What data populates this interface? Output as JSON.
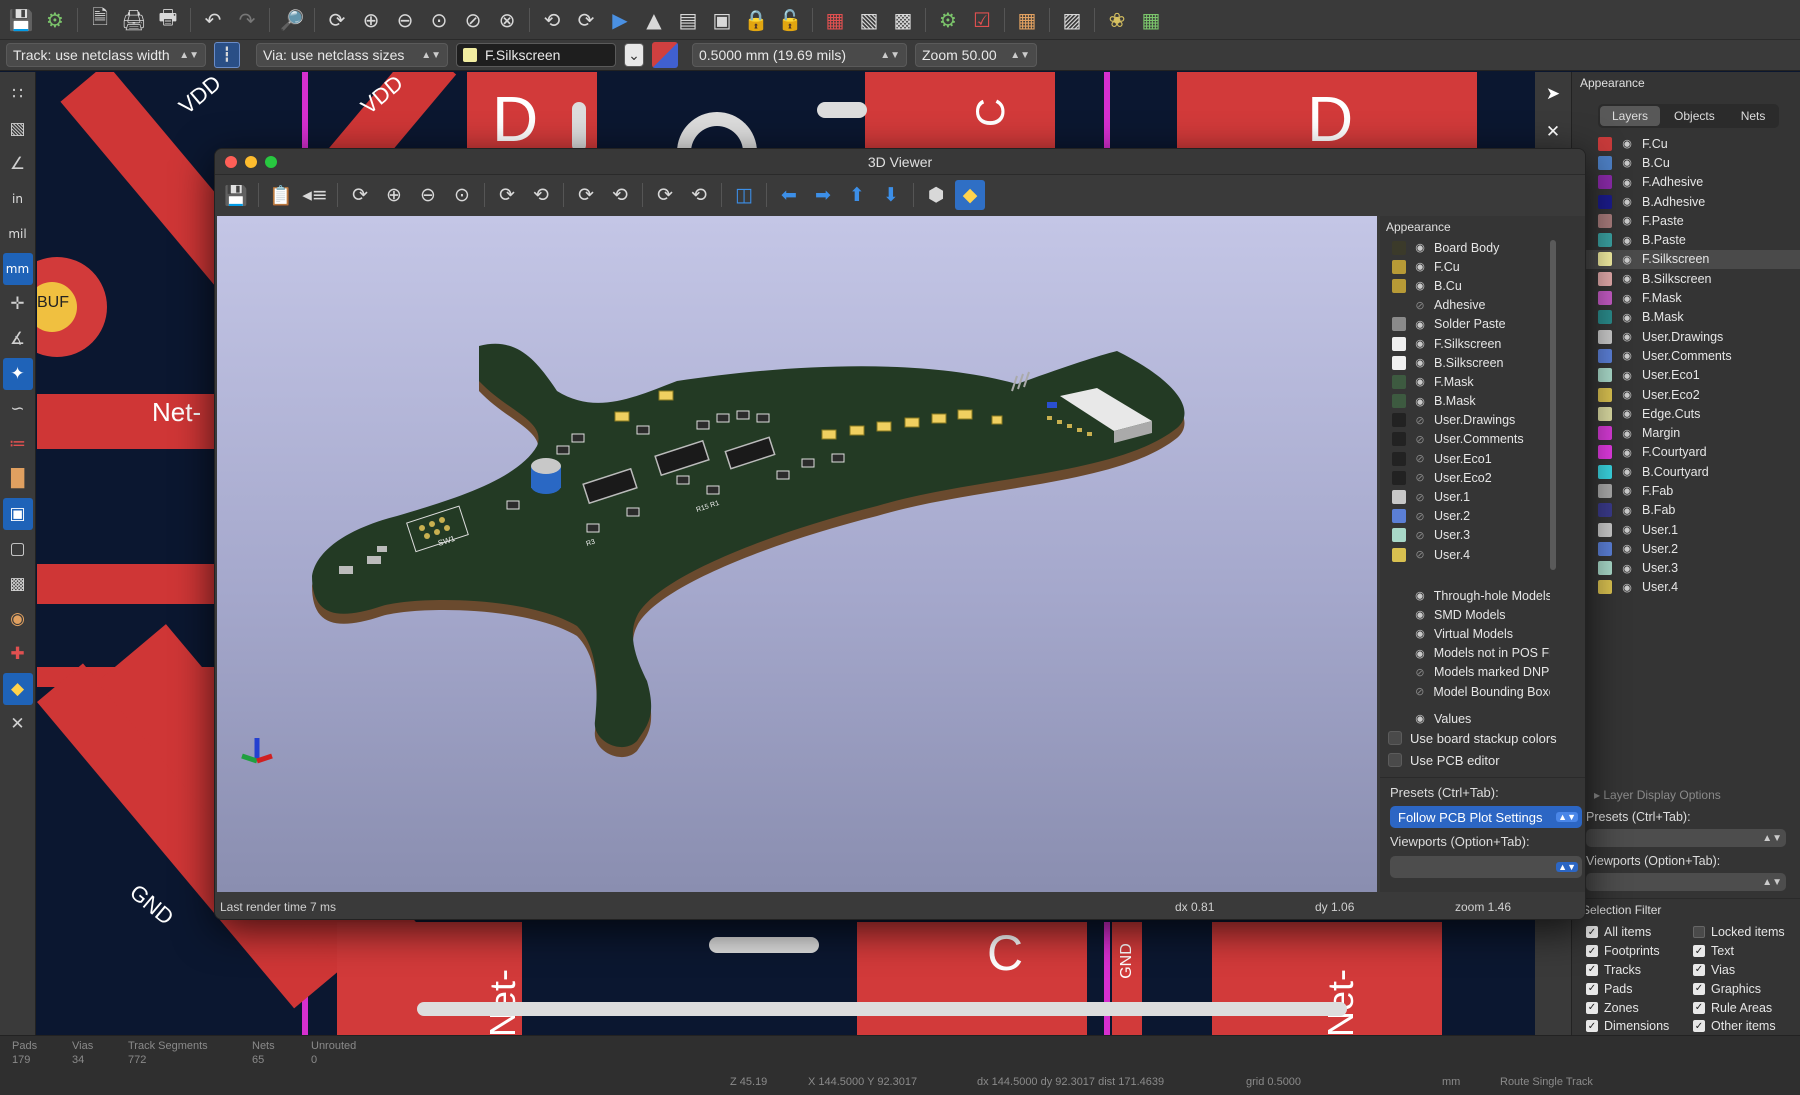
{
  "toolbar2": {
    "track_width": "Track: use netclass width",
    "via_size": "Via: use netclass sizes",
    "active_layer": "F.Silkscreen",
    "grid": "0.5000 mm (19.69 mils)",
    "zoom": "Zoom 50.00"
  },
  "left_toolbar": {
    "in": "in",
    "mil": "mil",
    "mm": "mm"
  },
  "canvas": {
    "labels": {
      "vdd1": "VDD",
      "vdd2": "VDD",
      "net_left": "Net-",
      "buf": "BUF",
      "gnd": "GND",
      "gnd2": "GND",
      "net_b1": "Net-",
      "net_b2": "Net-",
      "d1": "D",
      "d2": "D",
      "c1": "C",
      "c2": "C"
    }
  },
  "viewer": {
    "title": "3D Viewer",
    "status": {
      "render_time": "Last render time 7 ms",
      "dx": "dx 0.81",
      "dy": "dy 1.06",
      "zoom": "zoom 1.46"
    },
    "appearance_title": "Appearance",
    "layers": [
      {
        "name": "Board Body",
        "color": "#3b3a2a",
        "eye": true
      },
      {
        "name": "F.Cu",
        "color": "#b79a36",
        "eye": true
      },
      {
        "name": "B.Cu",
        "color": "#b79a36",
        "eye": true
      },
      {
        "name": "Adhesive",
        "color": "",
        "eye": false
      },
      {
        "name": "Solder Paste",
        "color": "#8a8a8a",
        "eye": true
      },
      {
        "name": "F.Silkscreen",
        "color": "#f0f0f0",
        "eye": true
      },
      {
        "name": "B.Silkscreen",
        "color": "#f0f0f0",
        "eye": true
      },
      {
        "name": "F.Mask",
        "color": "#3d5a40",
        "eye": true
      },
      {
        "name": "B.Mask",
        "color": "#3d5a40",
        "eye": true
      },
      {
        "name": "User.Drawings",
        "color": "#222222",
        "eye": false
      },
      {
        "name": "User.Comments",
        "color": "#222222",
        "eye": false
      },
      {
        "name": "User.Eco1",
        "color": "#222222",
        "eye": false
      },
      {
        "name": "User.Eco2",
        "color": "#222222",
        "eye": false
      },
      {
        "name": "User.1",
        "color": "#c8c8c8",
        "eye": false
      },
      {
        "name": "User.2",
        "color": "#5b7fd6",
        "eye": false
      },
      {
        "name": "User.3",
        "color": "#a8d8c8",
        "eye": false
      },
      {
        "name": "User.4",
        "color": "#d8c050",
        "eye": false
      }
    ],
    "models": [
      {
        "name": "Through-hole Models",
        "eye": true
      },
      {
        "name": "SMD Models",
        "eye": true
      },
      {
        "name": "Virtual Models",
        "eye": true
      },
      {
        "name": "Models not in POS Fi",
        "eye": true
      },
      {
        "name": "Models marked DNP",
        "eye": false
      },
      {
        "name": "Model Bounding Boxe",
        "eye": false
      }
    ],
    "values_label": "Values",
    "use_stackup": "Use board stackup colors",
    "use_pcb_editor": "Use PCB editor",
    "presets_label": "Presets (Ctrl+Tab):",
    "presets_value": "Follow PCB Plot Settings",
    "viewports_label": "Viewports (Option+Tab):",
    "silk_labels": {
      "sw1": "SW1",
      "r3": "R3",
      "r15": "R15 R1"
    }
  },
  "appearance": {
    "title": "Appearance",
    "tabs": [
      "Layers",
      "Objects",
      "Nets"
    ],
    "selected_tab": "Layers",
    "layers": [
      {
        "name": "F.Cu",
        "color": "#c83b3b"
      },
      {
        "name": "B.Cu",
        "color": "#4d7fc4"
      },
      {
        "name": "F.Adhesive",
        "color": "#8a2aa8"
      },
      {
        "name": "B.Adhesive",
        "color": "#1b1b8a"
      },
      {
        "name": "F.Paste",
        "color": "#a67a7a"
      },
      {
        "name": "B.Paste",
        "color": "#3aa0a0"
      },
      {
        "name": "F.Silkscreen",
        "color": "#f2eda1"
      },
      {
        "name": "B.Silkscreen",
        "color": "#e0a8a8"
      },
      {
        "name": "F.Mask",
        "color": "#c25ac2"
      },
      {
        "name": "B.Mask",
        "color": "#2a8a8a"
      },
      {
        "name": "User.Drawings",
        "color": "#c8c8c8"
      },
      {
        "name": "User.Comments",
        "color": "#5b7fd6"
      },
      {
        "name": "User.Eco1",
        "color": "#a8d8c8"
      },
      {
        "name": "User.Eco2",
        "color": "#d8c050"
      },
      {
        "name": "Edge.Cuts",
        "color": "#d8d8a0"
      },
      {
        "name": "Margin",
        "color": "#d43ad4"
      },
      {
        "name": "F.Courtyard",
        "color": "#e03ae0"
      },
      {
        "name": "B.Courtyard",
        "color": "#3ad4e0"
      },
      {
        "name": "F.Fab",
        "color": "#a8a8a8"
      },
      {
        "name": "B.Fab",
        "color": "#3a3a8a"
      },
      {
        "name": "User.1",
        "color": "#c8c8c8"
      },
      {
        "name": "User.2",
        "color": "#5b7fd6"
      },
      {
        "name": "User.3",
        "color": "#a8d8c8"
      },
      {
        "name": "User.4",
        "color": "#d8c050"
      }
    ],
    "selected_layer": "F.Silkscreen",
    "layer_display_options": "Layer Display Options",
    "presets_label": "Presets (Ctrl+Tab):",
    "viewports_label": "Viewports (Option+Tab):",
    "selection_filter_title": "Selection Filter",
    "filters_left": [
      {
        "label": "All items",
        "checked": true
      },
      {
        "label": "Footprints",
        "checked": true
      },
      {
        "label": "Tracks",
        "checked": true
      },
      {
        "label": "Pads",
        "checked": true
      },
      {
        "label": "Zones",
        "checked": true
      },
      {
        "label": "Dimensions",
        "checked": true
      }
    ],
    "filters_right": [
      {
        "label": "Locked items",
        "checked": false
      },
      {
        "label": "Text",
        "checked": true
      },
      {
        "label": "Vias",
        "checked": true
      },
      {
        "label": "Graphics",
        "checked": true
      },
      {
        "label": "Rule Areas",
        "checked": true
      },
      {
        "label": "Other items",
        "checked": true
      }
    ]
  },
  "status": {
    "pads_label": "Pads",
    "pads_value": "179",
    "vias_label": "Vias",
    "vias_value": "34",
    "tracks_label": "Track Segments",
    "tracks_value": "772",
    "nets_label": "Nets",
    "nets_value": "65",
    "unrouted_label": "Unrouted",
    "unrouted_value": "0",
    "z": "Z 45.19",
    "xy": "X 144.5000  Y 92.3017",
    "dxdy": "dx 144.5000  dy 92.3017  dist 171.4639",
    "grid": "grid 0.5000",
    "units": "mm",
    "mode": "Route Single Track"
  }
}
